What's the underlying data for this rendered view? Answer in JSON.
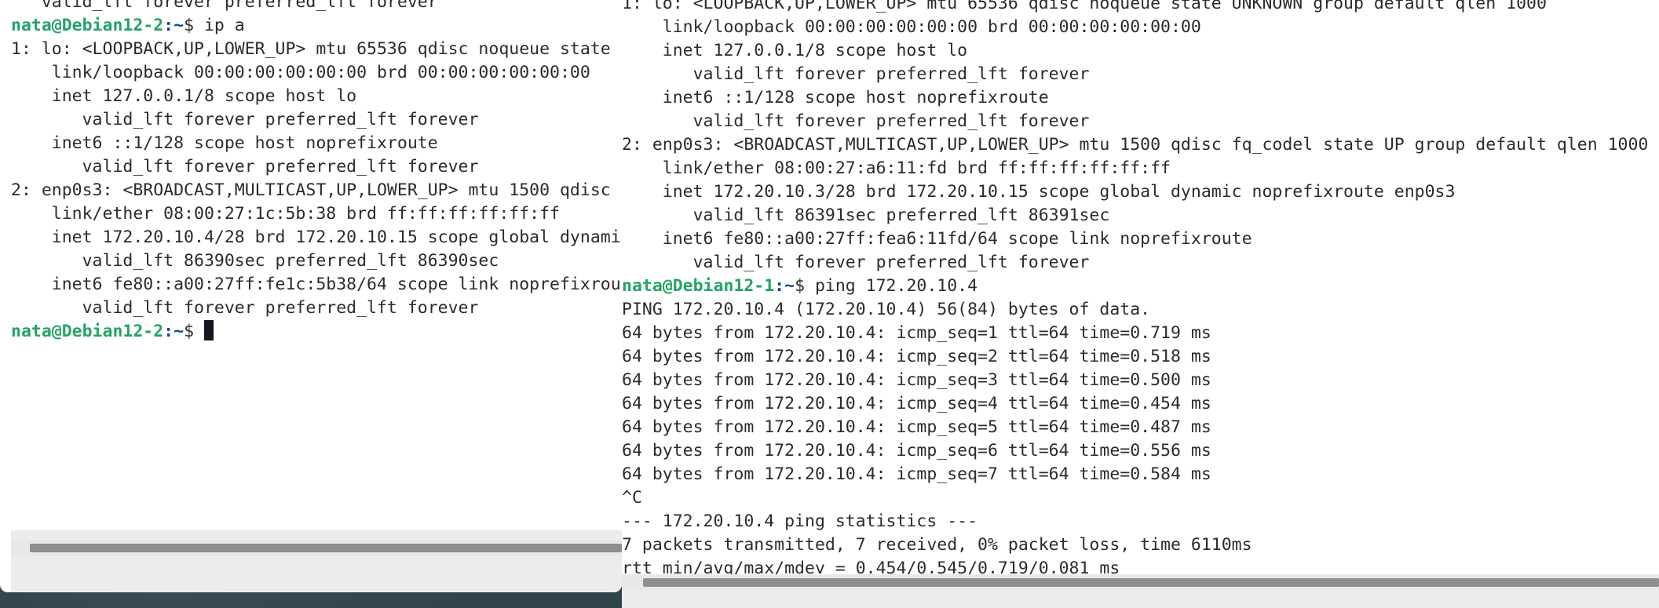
{
  "left_terminal": {
    "lines": [
      "   valid_lft forever preferred_lft forever",
      "",
      "1: lo: <LOOPBACK,UP,LOWER_UP> mtu 65536 qdisc noqueue state",
      "    link/loopback 00:00:00:00:00:00 brd 00:00:00:00:00:00",
      "    inet 127.0.0.1/8 scope host lo",
      "       valid_lft forever preferred_lft forever",
      "    inet6 ::1/128 scope host noprefixroute",
      "       valid_lft forever preferred_lft forever",
      "2: enp0s3: <BROADCAST,MULTICAST,UP,LOWER_UP> mtu 1500 qdisc",
      "    link/ether 08:00:27:1c:5b:38 brd ff:ff:ff:ff:ff:ff",
      "    inet 172.20.10.4/28 brd 172.20.10.15 scope global dynami",
      "       valid_lft 86390sec preferred_lft 86390sec",
      "    inet6 fe80::a00:27ff:fe1c:5b38/64 scope link noprefixrou",
      "       valid_lft forever preferred_lft forever"
    ],
    "prompt1_user": "nata@Debian12-2",
    "prompt1_path": ":~",
    "prompt1_sign": "$ ",
    "prompt1_command": "ip a",
    "prompt2_user": "nata@Debian12-2",
    "prompt2_path": ":~",
    "prompt2_sign": "$ "
  },
  "right_terminal": {
    "lines_before": [
      "1: lo: <LOOPBACK,UP,LOWER_UP> mtu 65536 qdisc noqueue state UNKNOWN group default qlen 1000",
      "    link/loopback 00:00:00:00:00:00 brd 00:00:00:00:00:00",
      "    inet 127.0.0.1/8 scope host lo",
      "       valid_lft forever preferred_lft forever",
      "    inet6 ::1/128 scope host noprefixroute",
      "       valid_lft forever preferred_lft forever",
      "2: enp0s3: <BROADCAST,MULTICAST,UP,LOWER_UP> mtu 1500 qdisc fq_codel state UP group default qlen 1000",
      "    link/ether 08:00:27:a6:11:fd brd ff:ff:ff:ff:ff:ff",
      "    inet 172.20.10.3/28 brd 172.20.10.15 scope global dynamic noprefixroute enp0s3",
      "       valid_lft 86391sec preferred_lft 86391sec",
      "    inet6 fe80::a00:27ff:fea6:11fd/64 scope link noprefixroute",
      "       valid_lft forever preferred_lft forever"
    ],
    "prompt_user": "nata@Debian12-1",
    "prompt_path": ":~",
    "prompt_sign": "$ ",
    "prompt_command": "ping 172.20.10.4",
    "lines_after": [
      "PING 172.20.10.4 (172.20.10.4) 56(84) bytes of data.",
      "64 bytes from 172.20.10.4: icmp_seq=1 ttl=64 time=0.719 ms",
      "64 bytes from 172.20.10.4: icmp_seq=2 ttl=64 time=0.518 ms",
      "64 bytes from 172.20.10.4: icmp_seq=3 ttl=64 time=0.500 ms",
      "64 bytes from 172.20.10.4: icmp_seq=4 ttl=64 time=0.454 ms",
      "64 bytes from 172.20.10.4: icmp_seq=5 ttl=64 time=0.487 ms",
      "64 bytes from 172.20.10.4: icmp_seq=6 ttl=64 time=0.556 ms",
      "64 bytes from 172.20.10.4: icmp_seq=7 ttl=64 time=0.584 ms",
      "^C",
      "--- 172.20.10.4 ping statistics ---",
      "7 packets transmitted, 7 received, 0% packet loss, time 6110ms",
      "rtt min/avg/max/mdev = 0.454/0.545/0.719/0.081 ms"
    ]
  },
  "colors": {
    "prompt_user": "#26a269",
    "prompt_path": "#12488b",
    "terminal_bg": "#ffffff",
    "terminal_fg": "#2b2b2b"
  }
}
